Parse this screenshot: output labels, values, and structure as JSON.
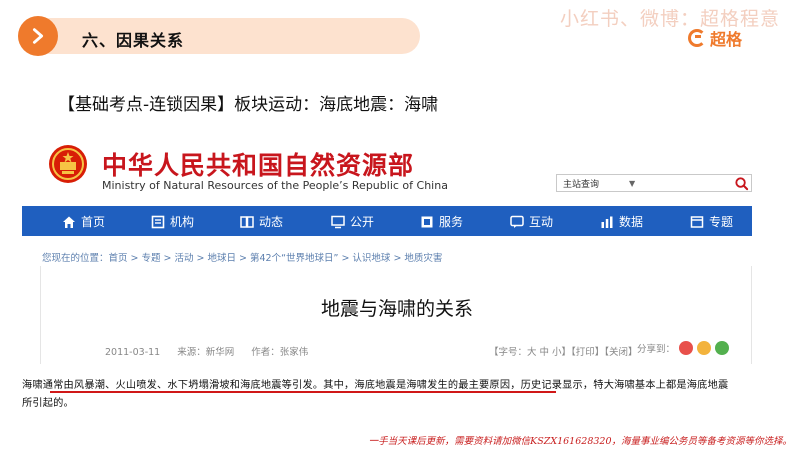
{
  "slide": {
    "section_title": "六、因果关系",
    "watermark": "小红书、微博：超格程意",
    "brand": "超格",
    "heading": "【基础考点-连锁因果】板块运动：海底地震：海啸"
  },
  "site": {
    "name_cn": "中华人民共和国自然资源部",
    "name_en": "Ministry of Natural Resources of the People’s Republic of China",
    "search_select": "主站查询",
    "nav": [
      {
        "label": "首页",
        "icon": "home-icon"
      },
      {
        "label": "机构",
        "icon": "org-icon"
      },
      {
        "label": "动态",
        "icon": "news-icon"
      },
      {
        "label": "公开",
        "icon": "monitor-icon"
      },
      {
        "label": "服务",
        "icon": "service-icon"
      },
      {
        "label": "互动",
        "icon": "chat-icon"
      },
      {
        "label": "数据",
        "icon": "chart-icon"
      },
      {
        "label": "专题",
        "icon": "topic-icon"
      }
    ],
    "breadcrumb": "您现在的位置：首页 > 专题 > 活动 > 地球日 > 第42个“世界地球日” > 认识地球 > 地质灾害"
  },
  "article": {
    "title": "地震与海啸的关系",
    "date": "2011-03-11",
    "source": "来源：新华网",
    "author": "作者：张家伟",
    "tools": "【字号：大 中 小】【打印】【关闭】",
    "share": "分享到："
  },
  "quote": {
    "line1": "海啸通常由风暴潮、火山喷发、水下坍塌滑坡和海底地震等引发。其中，海底地震是海啸发生的最主要原因，历史记录显示，特大海啸基本上都是海底地震",
    "line2": "所引起的。"
  },
  "footer": {
    "note": "一手当天课后更新，需要资料请加微信KSZX161628320，海量事业编公务员等备考资源等你选择。"
  },
  "colors": {
    "accent": "#ef7a2c",
    "site_red": "#c8161d",
    "nav_blue": "#1f5fbf",
    "underline_red": "#d01818"
  }
}
